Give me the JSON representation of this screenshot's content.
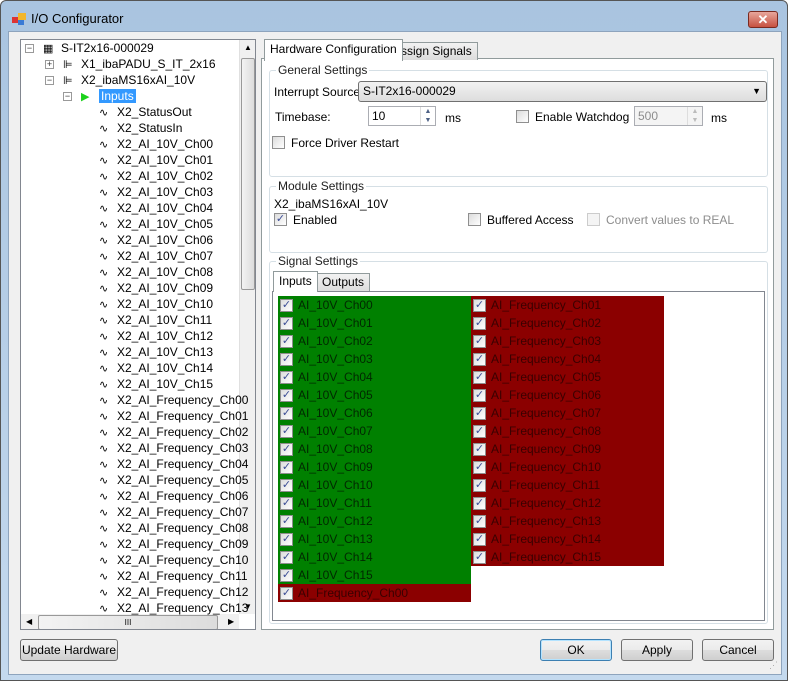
{
  "window": {
    "title": "I/O Configurator",
    "close_icon": "close-icon"
  },
  "tree": {
    "root": "S-IT2x16-000029",
    "modules": [
      "X1_ibaPADU_S_IT_2x16",
      "X2_ibaMS16xAI_10V"
    ],
    "inputs_node": "Inputs",
    "signals": [
      "X2_StatusOut",
      "X2_StatusIn",
      "X2_AI_10V_Ch00",
      "X2_AI_10V_Ch01",
      "X2_AI_10V_Ch02",
      "X2_AI_10V_Ch03",
      "X2_AI_10V_Ch04",
      "X2_AI_10V_Ch05",
      "X2_AI_10V_Ch06",
      "X2_AI_10V_Ch07",
      "X2_AI_10V_Ch08",
      "X2_AI_10V_Ch09",
      "X2_AI_10V_Ch10",
      "X2_AI_10V_Ch11",
      "X2_AI_10V_Ch12",
      "X2_AI_10V_Ch13",
      "X2_AI_10V_Ch14",
      "X2_AI_10V_Ch15",
      "X2_AI_Frequency_Ch00",
      "X2_AI_Frequency_Ch01",
      "X2_AI_Frequency_Ch02",
      "X2_AI_Frequency_Ch03",
      "X2_AI_Frequency_Ch04",
      "X2_AI_Frequency_Ch05",
      "X2_AI_Frequency_Ch06",
      "X2_AI_Frequency_Ch07",
      "X2_AI_Frequency_Ch08",
      "X2_AI_Frequency_Ch09",
      "X2_AI_Frequency_Ch10",
      "X2_AI_Frequency_Ch11",
      "X2_AI_Frequency_Ch12",
      "X2_AI_Frequency_Ch13"
    ],
    "hscroll_grip": "III"
  },
  "tabs": [
    {
      "label": "Hardware Configuration",
      "active": true
    },
    {
      "label": "Assign Signals",
      "active": false
    }
  ],
  "general": {
    "legend": "General Settings",
    "interrupt_label": "Interrupt Source:",
    "interrupt_value": "S-IT2x16-000029",
    "timebase_label": "Timebase:",
    "timebase_value": "10",
    "unit": "ms",
    "watchdog_label": "Enable Watchdog",
    "watchdog_checked": false,
    "watchdog_value": "500",
    "force_restart_label": "Force Driver Restart",
    "force_restart_checked": false
  },
  "module": {
    "legend": "Module Settings",
    "name": "X2_ibaMS16xAI_10V",
    "enabled_label": "Enabled",
    "enabled_checked": true,
    "buffered_label": "Buffered Access",
    "buffered_checked": false,
    "convert_label": "Convert values to REAL",
    "convert_checked": false
  },
  "signal": {
    "legend": "Signal Settings",
    "tabs": [
      "Inputs",
      "Outputs"
    ],
    "green_list": [
      "AI_10V_Ch00",
      "AI_10V_Ch01",
      "AI_10V_Ch02",
      "AI_10V_Ch03",
      "AI_10V_Ch04",
      "AI_10V_Ch05",
      "AI_10V_Ch06",
      "AI_10V_Ch07",
      "AI_10V_Ch08",
      "AI_10V_Ch09",
      "AI_10V_Ch10",
      "AI_10V_Ch11",
      "AI_10V_Ch12",
      "AI_10V_Ch13",
      "AI_10V_Ch14",
      "AI_10V_Ch15"
    ],
    "red_list": [
      "AI_Frequency_Ch01",
      "AI_Frequency_Ch02",
      "AI_Frequency_Ch03",
      "AI_Frequency_Ch04",
      "AI_Frequency_Ch05",
      "AI_Frequency_Ch06",
      "AI_Frequency_Ch07",
      "AI_Frequency_Ch08",
      "AI_Frequency_Ch09",
      "AI_Frequency_Ch10",
      "AI_Frequency_Ch11",
      "AI_Frequency_Ch12",
      "AI_Frequency_Ch13",
      "AI_Frequency_Ch14",
      "AI_Frequency_Ch15"
    ],
    "extra_red": "AI_Frequency_Ch00",
    "colors": {
      "green": "#008000",
      "red": "#8b0000"
    }
  },
  "buttons": {
    "update": "Update Hardware",
    "ok": "OK",
    "apply": "Apply",
    "cancel": "Cancel"
  }
}
